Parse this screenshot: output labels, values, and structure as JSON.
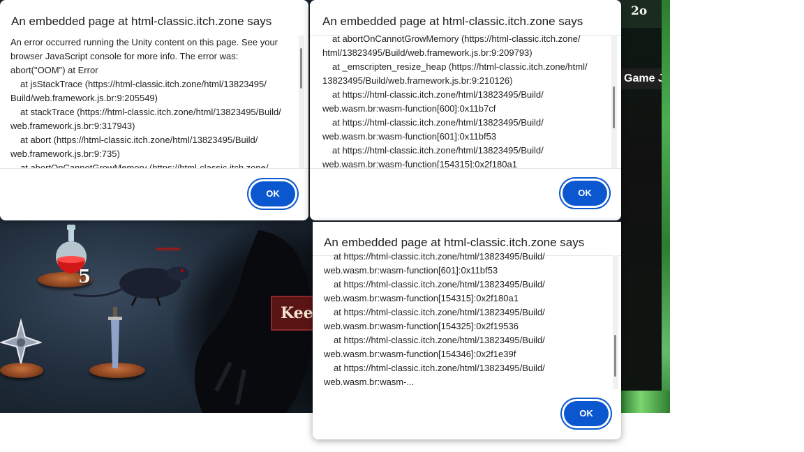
{
  "game": {
    "score": "2o",
    "jam_label": "Game Jam",
    "banner_text": "Keep",
    "potion_count": "5"
  },
  "dialogs": [
    {
      "title": "An embedded page at html-classic.itch.zone says",
      "lines": [
        "An error occurred running the Unity content on this page. See your",
        "browser JavaScript console for more info. The error was:",
        "abort(\"OOM\") at Error",
        "    at jsStackTrace (https://html-classic.itch.zone/html/13823495/",
        "Build/web.framework.js.br:9:205549)",
        "    at stackTrace (https://html-classic.itch.zone/html/13823495/Build/",
        "web.framework.js.br:9:317943)",
        "    at abort (https://html-classic.itch.zone/html/13823495/Build/",
        "web.framework.js.br:9:735)",
        "    at abortOnCannotGrowMemory (https://html-classic.itch.zone/"
      ],
      "ok_label": "OK"
    },
    {
      "title": "An embedded page at html-classic.itch.zone says",
      "lines": [
        "    at abortOnCannotGrowMemory (https://html-classic.itch.zone/",
        "html/13823495/Build/web.framework.js.br:9:209793)",
        "    at _emscripten_resize_heap (https://html-classic.itch.zone/html/",
        "13823495/Build/web.framework.js.br:9:210126)",
        "    at https://html-classic.itch.zone/html/13823495/Build/",
        "web.wasm.br:wasm-function[600]:0x11b7cf",
        "    at https://html-classic.itch.zone/html/13823495/Build/",
        "web.wasm.br:wasm-function[601]:0x11bf53",
        "    at https://html-classic.itch.zone/html/13823495/Build/",
        "web.wasm.br:wasm-function[154315]:0x2f180a1"
      ],
      "ok_label": "OK"
    },
    {
      "title": "An embedded page at html-classic.itch.zone says",
      "lines": [
        "    at https://html-classic.itch.zone/html/13823495/Build/",
        "web.wasm.br:wasm-function[601]:0x11bf53",
        "    at https://html-classic.itch.zone/html/13823495/Build/",
        "web.wasm.br:wasm-function[154315]:0x2f180a1",
        "    at https://html-classic.itch.zone/html/13823495/Build/",
        "web.wasm.br:wasm-function[154325]:0x2f19536",
        "    at https://html-classic.itch.zone/html/13823495/Build/",
        "web.wasm.br:wasm-function[154346]:0x2f1e39f",
        "    at https://html-classic.itch.zone/html/13823495/Build/",
        "web.wasm.br:wasm-..."
      ],
      "ok_label": "OK"
    }
  ]
}
